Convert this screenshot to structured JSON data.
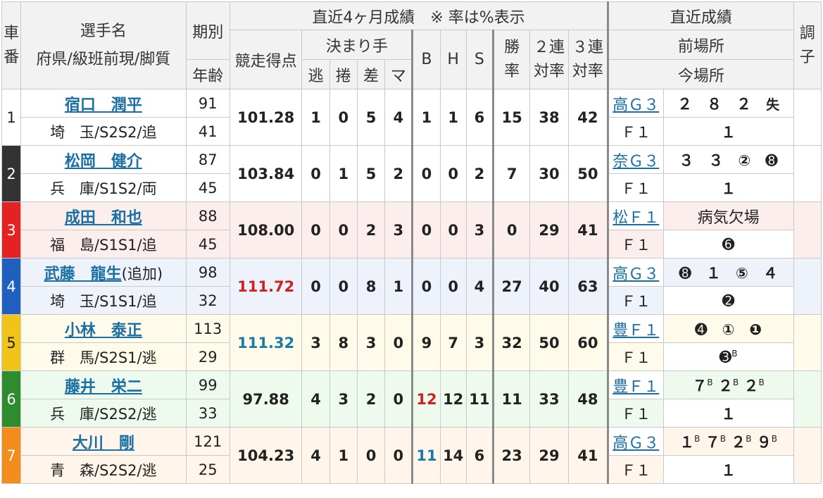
{
  "header": {
    "car_no": "車\n番",
    "racer": "選手名",
    "racer_sub": "府県/級班前現/脚質",
    "term": "期別",
    "age": "年齢",
    "recent4": "直近4ヶ月成績　※ 率は%表示",
    "score": "競走得点",
    "kimarite": "決まり手",
    "k_nige": "逃",
    "k_makuri": "捲",
    "k_sashi": "差",
    "k_mark": "マ",
    "b": "B",
    "h": "H",
    "s": "S",
    "win_rate": "勝\n率",
    "rate2": "２連\n対率",
    "rate3": "３連\n対率",
    "recent_results": "直近成績",
    "prev_venue": "前場所",
    "cur_venue": "今場所",
    "condition": "調\n子"
  },
  "colors": {
    "car1": "#ffffff",
    "car2": "#333333",
    "car3": "#e52222",
    "car4": "#1f5fbf",
    "car5": "#f0c419",
    "car6": "#2e8b2e",
    "car7": "#f28c1a",
    "row1": "#ffffff",
    "row2": "#ffffff",
    "row3": "#fdeeee",
    "row4": "#edf2fb",
    "row5": "#fffbea",
    "row6": "#eefaee",
    "row7": "#fff5ea"
  },
  "racers": [
    {
      "no": "1",
      "name": "宿口　潤平",
      "extra": "",
      "info": "埼　玉/S2S2/追",
      "term": "91",
      "age": "41",
      "score": "101.28",
      "score_color": "",
      "nige": "1",
      "makuri": "0",
      "sashi": "5",
      "mark": "4",
      "b": "1",
      "b_color": "",
      "h": "1",
      "s": "6",
      "win": "15",
      "r2": "38",
      "r3": "42",
      "prev_venue": "高Ｇ３",
      "prev_results": "２　８　２　<span style='font-size:19px'>失</span>",
      "cur_venue": "Ｆ１",
      "cur_results": "１"
    },
    {
      "no": "2",
      "name": "松岡　健介",
      "extra": "",
      "info": "兵　庫/S1S2/両",
      "term": "87",
      "age": "45",
      "score": "103.84",
      "score_color": "",
      "nige": "0",
      "makuri": "1",
      "sashi": "5",
      "mark": "2",
      "b": "0",
      "b_color": "",
      "h": "0",
      "s": "2",
      "win": "7",
      "r2": "30",
      "r3": "50",
      "prev_venue": "奈Ｇ３",
      "prev_results": "３　３　②　➑",
      "cur_venue": "Ｆ１",
      "cur_results": "１"
    },
    {
      "no": "3",
      "name": "成田　和也",
      "extra": "",
      "info": "福　島/S1S1/追",
      "term": "88",
      "age": "45",
      "score": "108.00",
      "score_color": "",
      "nige": "0",
      "makuri": "0",
      "sashi": "2",
      "mark": "3",
      "b": "0",
      "b_color": "",
      "h": "0",
      "s": "3",
      "win": "0",
      "r2": "29",
      "r3": "41",
      "prev_venue": "松Ｆ１",
      "prev_results": "<span style='font-weight:normal;font-size:22px'>病気欠場</span>",
      "cur_venue": "Ｆ１",
      "cur_results": "➏"
    },
    {
      "no": "4",
      "name": "武藤　龍生",
      "extra": "(追加)",
      "info": "埼　玉/S1S1/追",
      "term": "98",
      "age": "32",
      "score": "111.72",
      "score_color": "red",
      "nige": "0",
      "makuri": "0",
      "sashi": "8",
      "mark": "1",
      "b": "0",
      "b_color": "",
      "h": "0",
      "s": "4",
      "win": "27",
      "r2": "40",
      "r3": "63",
      "prev_venue": "高Ｇ３",
      "prev_results": "➑　１　⑤　４",
      "cur_venue": "Ｆ１",
      "cur_results": "➋"
    },
    {
      "no": "5",
      "name": "小林　泰正",
      "extra": "",
      "info": "群　馬/S2S1/逃",
      "term": "113",
      "age": "29",
      "score": "111.32",
      "score_color": "blue",
      "nige": "3",
      "makuri": "8",
      "sashi": "3",
      "mark": "0",
      "b": "9",
      "b_color": "",
      "h": "7",
      "s": "3",
      "win": "32",
      "r2": "50",
      "r3": "60",
      "prev_venue": "豊Ｆ１",
      "prev_results": "➍　①　❶",
      "cur_venue": "Ｆ１",
      "cur_results": "➌<sup>B</sup>"
    },
    {
      "no": "6",
      "name": "藤井　栄二",
      "extra": "",
      "info": "兵　庫/S2S2/逃",
      "term": "99",
      "age": "33",
      "score": "97.88",
      "score_color": "",
      "nige": "4",
      "makuri": "3",
      "sashi": "2",
      "mark": "0",
      "b": "12",
      "b_color": "red",
      "h": "12",
      "s": "11",
      "win": "11",
      "r2": "33",
      "r3": "48",
      "prev_venue": "豊Ｆ１",
      "prev_results": "７<sup>B</sup> ２<sup>B</sup> ２<sup>B</sup>",
      "cur_venue": "Ｆ１",
      "cur_results": "１"
    },
    {
      "no": "7",
      "name": "大川　剛",
      "extra": "",
      "info": "青　森/S2S2/逃",
      "term": "121",
      "age": "25",
      "score": "104.23",
      "score_color": "",
      "nige": "4",
      "makuri": "1",
      "sashi": "0",
      "mark": "0",
      "b": "11",
      "b_color": "blue",
      "h": "14",
      "s": "6",
      "win": "23",
      "r2": "29",
      "r3": "41",
      "prev_venue": "高Ｇ３",
      "prev_results": "１<sup>B</sup> ７<sup>B</sup> ２<sup>B</sup> ９<sup>B</sup>",
      "cur_venue": "Ｆ１",
      "cur_results": "１"
    }
  ]
}
